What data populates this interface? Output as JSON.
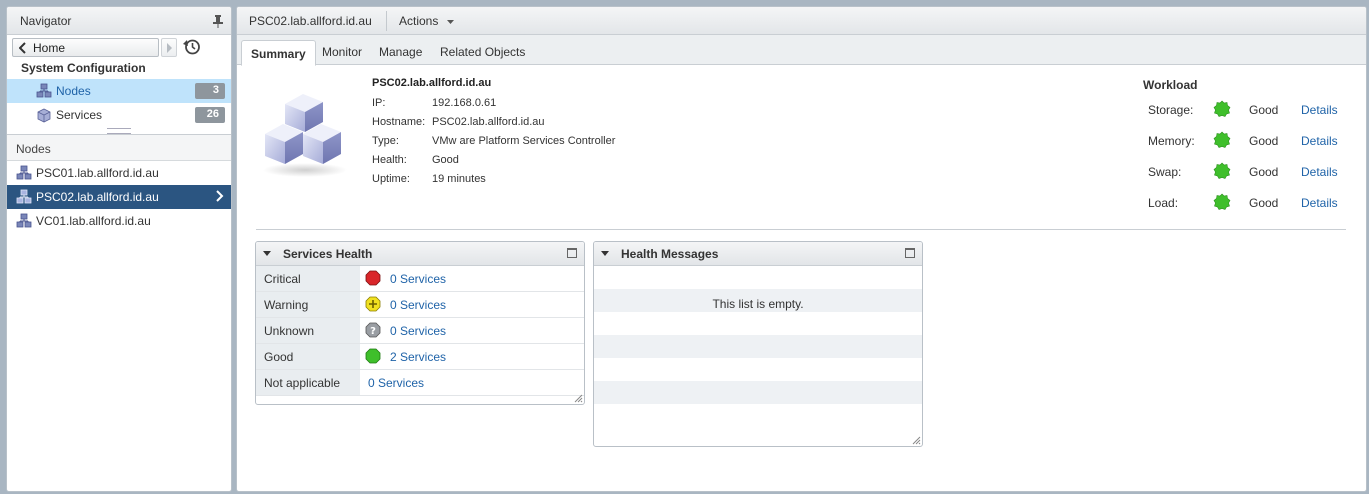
{
  "navigator": {
    "title": "Navigator",
    "home_label": "Home",
    "system_config_label": "System Configuration",
    "config_items": [
      {
        "label": "Nodes",
        "count": "3"
      },
      {
        "label": "Services",
        "count": "26"
      }
    ],
    "nodes_header": "Nodes",
    "nodes": [
      {
        "label": "PSC01.lab.allford.id.au"
      },
      {
        "label": "PSC02.lab.allford.id.au"
      },
      {
        "label": "VC01.lab.allford.id.au"
      }
    ]
  },
  "header": {
    "object_title": "PSC02.lab.allford.id.au",
    "actions_label": "Actions"
  },
  "tabs": [
    {
      "label": "Summary"
    },
    {
      "label": "Monitor"
    },
    {
      "label": "Manage"
    },
    {
      "label": "Related Objects"
    }
  ],
  "summary": {
    "name": "PSC02.lab.allford.id.au",
    "properties": [
      {
        "key": "IP:",
        "value": "192.168.0.61"
      },
      {
        "key": "Hostname:",
        "value": "PSC02.lab.allford.id.au"
      },
      {
        "key": "Type:",
        "value": "VMw are Platform Services Controller"
      },
      {
        "key": "Health:",
        "value": "Good"
      },
      {
        "key": "Uptime:",
        "value": "19 minutes"
      }
    ]
  },
  "workload": {
    "title": "Workload",
    "rows": [
      {
        "label": "Storage:",
        "status": "Good",
        "link": "Details"
      },
      {
        "label": "Memory:",
        "status": "Good",
        "link": "Details"
      },
      {
        "label": "Swap:",
        "status": "Good",
        "link": "Details"
      },
      {
        "label": "Load:",
        "status": "Good",
        "link": "Details"
      }
    ]
  },
  "services_health": {
    "title": "Services Health",
    "rows": [
      {
        "label": "Critical",
        "count": "0 Services",
        "icon": "critical-icon"
      },
      {
        "label": "Warning",
        "count": "0 Services",
        "icon": "warning-icon"
      },
      {
        "label": "Unknown",
        "count": "0 Services",
        "icon": "unknown-icon"
      },
      {
        "label": "Good",
        "count": "2 Services",
        "icon": "good-icon"
      },
      {
        "label": "Not applicable",
        "count": "0 Services",
        "icon": ""
      }
    ]
  },
  "health_messages": {
    "title": "Health Messages",
    "empty_text": "This list is empty."
  },
  "colors": {
    "selected_node_bg": "#2b5581",
    "selected_config_bg": "#bfe3fb",
    "link": "#1f63a8",
    "good_green": "#3fbf2b",
    "critical_red": "#d9262a",
    "warning_yellow": "#f0e020"
  }
}
